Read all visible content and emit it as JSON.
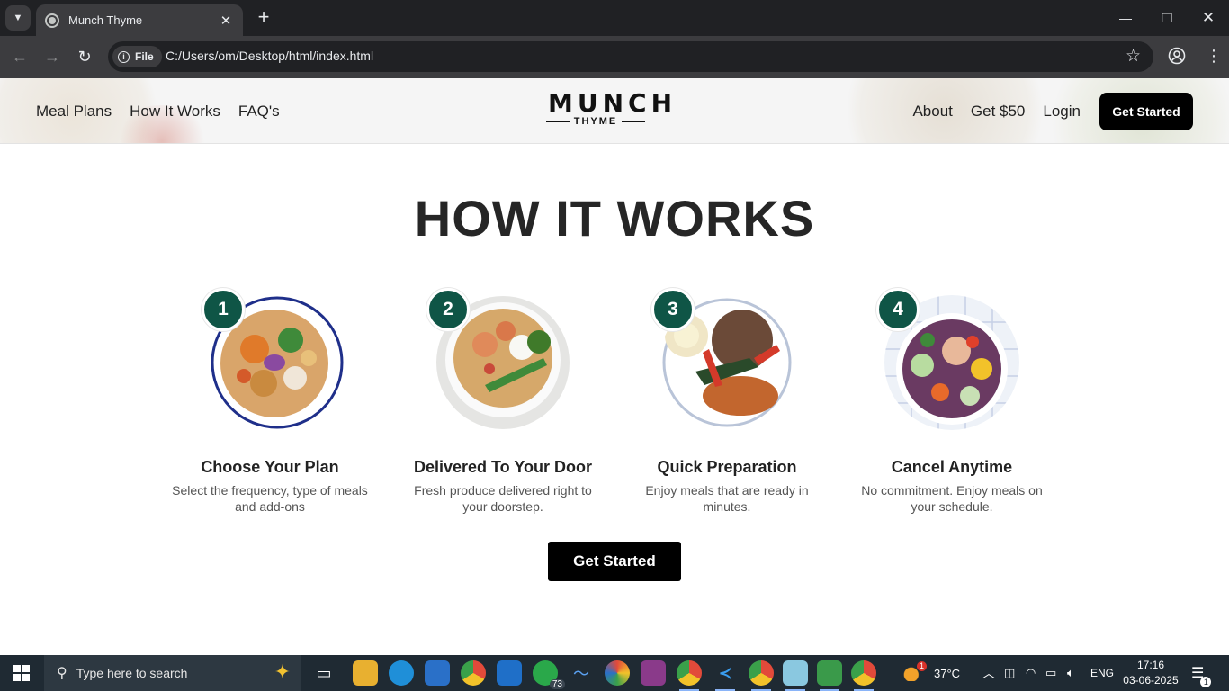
{
  "browser": {
    "tab_title": "Munch Thyme",
    "chip_label": "File",
    "url": "C:/Users/om/Desktop/html/index.html"
  },
  "site": {
    "nav_left": [
      "Meal Plans",
      "How It Works",
      "FAQ's"
    ],
    "nav_right": [
      "About",
      "Get $50",
      "Login"
    ],
    "header_cta": "Get Started",
    "logo_main": "MUNCH",
    "logo_sub": "THYME"
  },
  "main": {
    "title": "HOW IT WORKS",
    "steps": [
      {
        "number": "1",
        "title": "Choose Your Plan",
        "text": "Select the frequency, type of meals and add-ons"
      },
      {
        "number": "2",
        "title": "Delivered To Your Door",
        "text": "Fresh produce delivered right to your doorstep."
      },
      {
        "number": "3",
        "title": "Quick Preparation",
        "text": "Enjoy meals that are ready in minutes."
      },
      {
        "number": "4",
        "title": "Cancel Anytime",
        "text": "No commitment. Enjoy meals on your schedule."
      }
    ],
    "cta": "Get Started"
  },
  "taskbar": {
    "search_placeholder": "Type here to search",
    "whatsapp_badge": "73",
    "weather_alert": "1",
    "temperature": "37°C",
    "language": "ENG",
    "time": "17:16",
    "date": "03-06-2025",
    "notification_count": "1"
  },
  "colors": {
    "accent_green": "#0f5546",
    "cta_black": "#000000",
    "chrome_dark": "#202124",
    "taskbar": "#1f2a33"
  }
}
